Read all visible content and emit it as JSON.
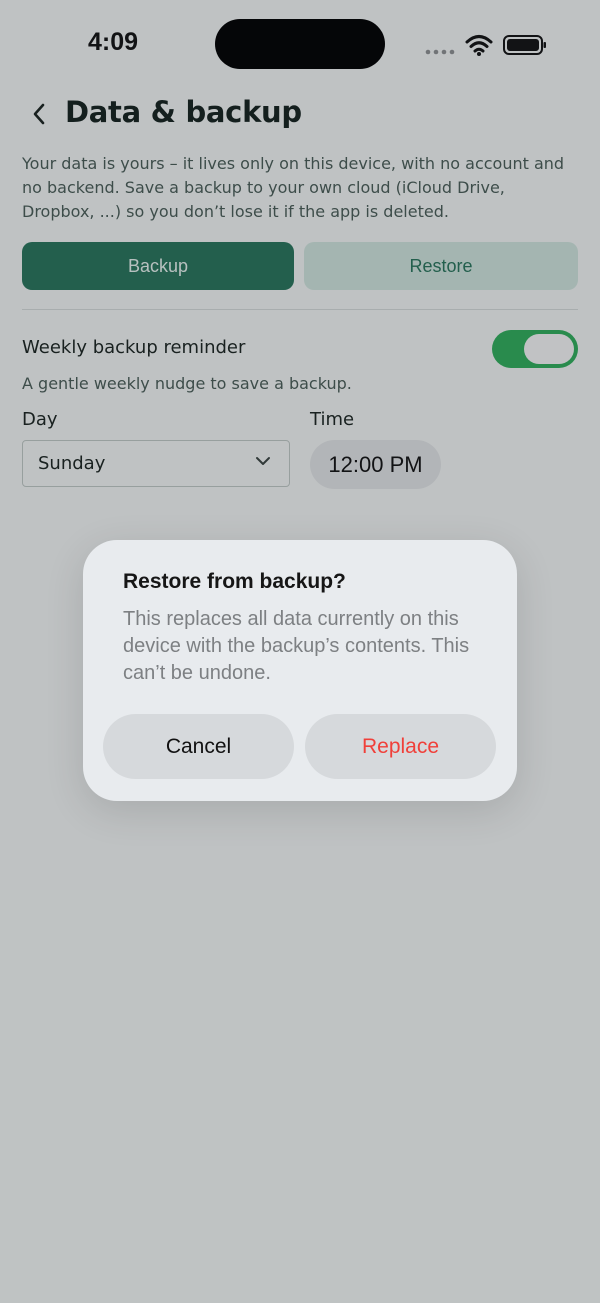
{
  "status": {
    "time": "4:09"
  },
  "header": {
    "title": "Data & backup"
  },
  "intro_text": "Your data is yours – it lives only on this device, with no account and no backend. Save a backup to your own cloud (iCloud Drive, Dropbox, ...) so you don’t lose it if the app is deleted.",
  "actions": {
    "backup_label": "Backup",
    "restore_label": "Restore"
  },
  "reminder": {
    "label": "Weekly backup reminder",
    "subtitle": "A gentle weekly nudge to save a backup.",
    "enabled": true,
    "day_label": "Day",
    "day_value": "Sunday",
    "time_label": "Time",
    "time_value": "12:00 PM"
  },
  "dialog": {
    "title": "Restore from backup?",
    "body": "This replaces all data currently on this device with the backup’s contents. This can’t be undone.",
    "cancel_label": "Cancel",
    "replace_label": "Replace"
  },
  "colors": {
    "primary": "#27745a",
    "primary_light": "#cfe4dc",
    "toggle_on": "#2fae5a",
    "destructive": "#f0403a"
  },
  "icons": {
    "back": "chevron-left-icon",
    "dropdown": "chevron-down-icon",
    "signal": "signal-icon",
    "wifi": "wifi-icon",
    "battery": "battery-icon"
  }
}
